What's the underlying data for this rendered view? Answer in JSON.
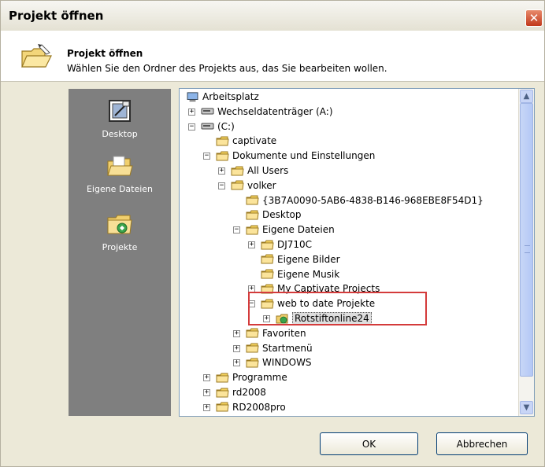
{
  "window": {
    "title": "Projekt öffnen",
    "close_glyph": "✕"
  },
  "header": {
    "title": "Projekt öffnen",
    "subtitle": "Wählen Sie den Ordner des Projekts aus, das Sie bearbeiten wollen.",
    "icon": "folder-open-icon"
  },
  "places": [
    {
      "label": "Desktop",
      "icon": "desktop-icon"
    },
    {
      "label": "Eigene Dateien",
      "icon": "my-documents-icon"
    },
    {
      "label": "Projekte",
      "icon": "projects-folder-icon"
    }
  ],
  "tree": {
    "rows": [
      {
        "label": "Arbeitsplatz",
        "icon": "computer-icon",
        "expander": ""
      },
      {
        "label": "Wechseldatenträger (A:)",
        "icon": "drive-icon",
        "expander": "+"
      },
      {
        "label": "(C:)",
        "icon": "drive-icon",
        "expander": "−"
      },
      {
        "label": "captivate",
        "icon": "folder-icon",
        "expander": ""
      },
      {
        "label": "Dokumente und Einstellungen",
        "icon": "folder-icon",
        "expander": "−"
      },
      {
        "label": "All Users",
        "icon": "folder-icon",
        "expander": "+"
      },
      {
        "label": "volker",
        "icon": "folder-icon",
        "expander": "−"
      },
      {
        "label": "{3B7A0090-5AB6-4838-B146-968EBE8F54D1}",
        "icon": "folder-icon",
        "expander": ""
      },
      {
        "label": "Desktop",
        "icon": "folder-icon",
        "expander": ""
      },
      {
        "label": "Eigene Dateien",
        "icon": "folder-icon",
        "expander": "−"
      },
      {
        "label": "DJ710C",
        "icon": "folder-icon",
        "expander": "+"
      },
      {
        "label": "Eigene Bilder",
        "icon": "folder-icon",
        "expander": ""
      },
      {
        "label": "Eigene Musik",
        "icon": "folder-icon",
        "expander": ""
      },
      {
        "label": "My Captivate Projects",
        "icon": "folder-icon",
        "expander": "+"
      },
      {
        "label": "web to date Projekte",
        "icon": "folder-icon",
        "expander": "−"
      },
      {
        "label": "Rotstiftonline24",
        "icon": "project-icon",
        "expander": "+"
      },
      {
        "label": "Favoriten",
        "icon": "folder-icon",
        "expander": "+"
      },
      {
        "label": "Startmenü",
        "icon": "folder-icon",
        "expander": "+"
      },
      {
        "label": "WINDOWS",
        "icon": "folder-icon",
        "expander": "+"
      },
      {
        "label": "Programme",
        "icon": "folder-icon",
        "expander": "+"
      },
      {
        "label": "rd2008",
        "icon": "folder-icon",
        "expander": "+"
      },
      {
        "label": "RD2008pro",
        "icon": "folder-icon",
        "expander": "+"
      },
      {
        "label": "",
        "icon": "folder-icon",
        "expander": "+"
      }
    ],
    "selected": "Rotstiftonline24"
  },
  "buttons": {
    "ok": "OK",
    "cancel": "Abbrechen"
  },
  "colors": {
    "places_bg": "#7f7f7f",
    "highlight": "#d43b3b",
    "folder": "#f4d35e"
  }
}
